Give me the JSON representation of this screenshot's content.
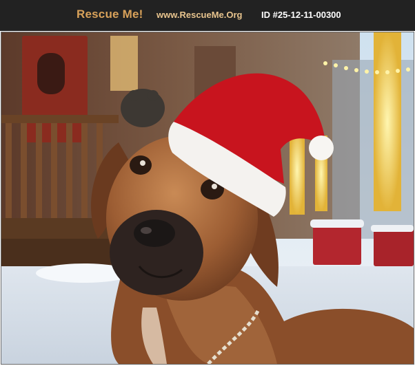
{
  "header": {
    "logo_text": "Rescue Me!",
    "site_link": "www.RescueMe.Org",
    "pet_id": "ID #25-12-11-00300"
  },
  "photo": {
    "subject": "dog-in-santa-hat",
    "colors": {
      "header_bg": "#222222",
      "logo": "#d9a25a",
      "link": "#e8c48e",
      "santa_red": "#c8141e"
    }
  }
}
